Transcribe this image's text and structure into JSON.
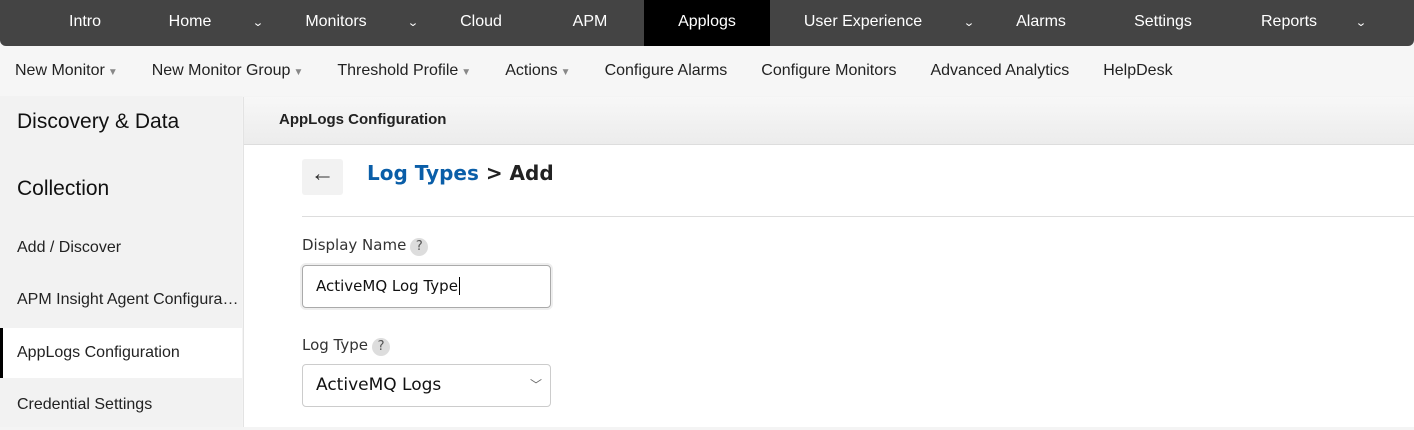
{
  "topnav": {
    "items": [
      {
        "label": "Intro"
      },
      {
        "label": "Home"
      },
      {
        "label": "Monitors"
      },
      {
        "label": "Cloud"
      },
      {
        "label": "APM"
      },
      {
        "label": "Applogs"
      },
      {
        "label": "User Experience"
      },
      {
        "label": "Alarms"
      },
      {
        "label": "Settings"
      },
      {
        "label": "Reports"
      }
    ],
    "active": "Applogs"
  },
  "subnav": {
    "items": [
      {
        "label": "New Monitor"
      },
      {
        "label": "New Monitor Group"
      },
      {
        "label": "Threshold Profile"
      },
      {
        "label": "Actions"
      },
      {
        "label": "Configure Alarms"
      },
      {
        "label": "Configure Monitors"
      },
      {
        "label": "Advanced Analytics"
      },
      {
        "label": "HelpDesk"
      }
    ]
  },
  "sidebar": {
    "title_line1": "Discovery & Data",
    "title_line2": "Collection",
    "items": [
      {
        "label": "Add / Discover"
      },
      {
        "label": "APM Insight Agent Configuration"
      },
      {
        "label": "AppLogs Configuration"
      },
      {
        "label": "Credential Settings"
      }
    ],
    "active": "AppLogs Configuration"
  },
  "content": {
    "header": "AppLogs Configuration",
    "breadcrumb_link": "Log Types",
    "breadcrumb_sep": " > ",
    "breadcrumb_current": "Add",
    "display_name_label": "Display Name",
    "display_name_value": "ActiveMQ Log Type",
    "log_type_label": "Log Type",
    "log_type_value": "ActiveMQ Logs",
    "help": "?"
  }
}
